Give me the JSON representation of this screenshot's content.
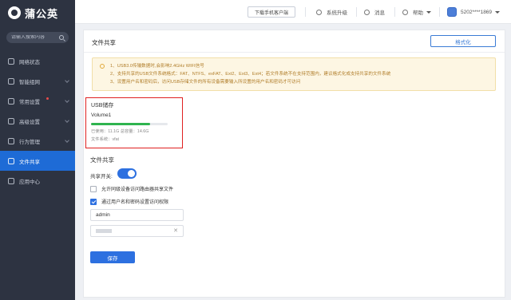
{
  "brand": {
    "name": "蒲公英"
  },
  "sidebar": {
    "search_placeholder": "请输入搜索内容",
    "items": [
      {
        "label": "网络状态",
        "has_chevron": false
      },
      {
        "label": "智能组网",
        "has_chevron": true
      },
      {
        "label": "常用设置",
        "has_chevron": true,
        "dot": true
      },
      {
        "label": "高级设置",
        "has_chevron": true
      },
      {
        "label": "行为管理",
        "has_chevron": true
      },
      {
        "label": "文件共享",
        "active": true
      },
      {
        "label": "应用中心",
        "has_chevron": false
      }
    ]
  },
  "topbar": {
    "app_download": "下载手机客户端",
    "upgrade": "系统升级",
    "messages": "消息",
    "help": "帮助",
    "account": "5202****1869"
  },
  "page": {
    "title": "文件共享",
    "format_button": "格式化",
    "notices": [
      "1、USB3.0传输数据时,会影响2.4GHz WIFI信号",
      "2、支持共享的USB文件系统格式：FAT、NTFS、exFAT、Ext2、Ext3、Ext4；若文件系统不在支持范围内，建议格式化成支持共享的文件系统",
      "3、设置用户名和密码后，访问USB存储文件的所有设备需要输入所设置的用户名和密码才可访问"
    ],
    "usb": {
      "title": "USB储存",
      "volume": "Volume1",
      "used_fraction": 0.77,
      "usage_text": "已使用：11.1G   总容量：14.6G",
      "fs_text": "文件系统：vfat"
    },
    "share": {
      "section_title": "文件共享",
      "switch_label": "共享开关:",
      "switch_on": true,
      "allow_same_network": "允许同级设备访问路由器共享文件",
      "allow_checked": false,
      "auth_label": "通过用户名和密码设置访问权限",
      "auth_checked": true,
      "username": "admin",
      "save_button": "保存"
    }
  },
  "colors": {
    "accent": "#2d70e0",
    "sidebar_bg": "#2d3341",
    "highlight": "#e02020",
    "progress": "#2fb44f"
  }
}
